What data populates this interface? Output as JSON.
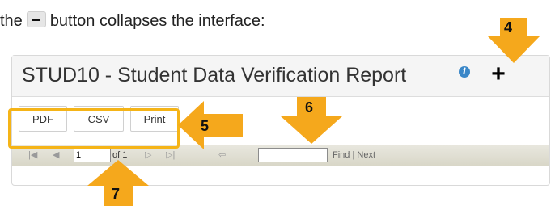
{
  "instruction": {
    "before": "the",
    "after": "button collapses the interface:"
  },
  "report": {
    "title": "STUD10 - Student Data Verification Report",
    "info_icon": "info-icon",
    "expand_icon": "plus-icon"
  },
  "export_buttons": [
    "PDF",
    "CSV",
    "Print"
  ],
  "toolbar": {
    "page_value": "1",
    "of_text": "of 1",
    "find_value": "",
    "find_label": "Find",
    "separator": "|",
    "next_label": "Next"
  },
  "callouts": {
    "c4": "4",
    "c5": "5",
    "c6": "6",
    "c7": "7"
  },
  "colors": {
    "callout_orange": "#f5a81c",
    "highlight_border": "#f5b417",
    "info_blue": "#3a87c8"
  }
}
